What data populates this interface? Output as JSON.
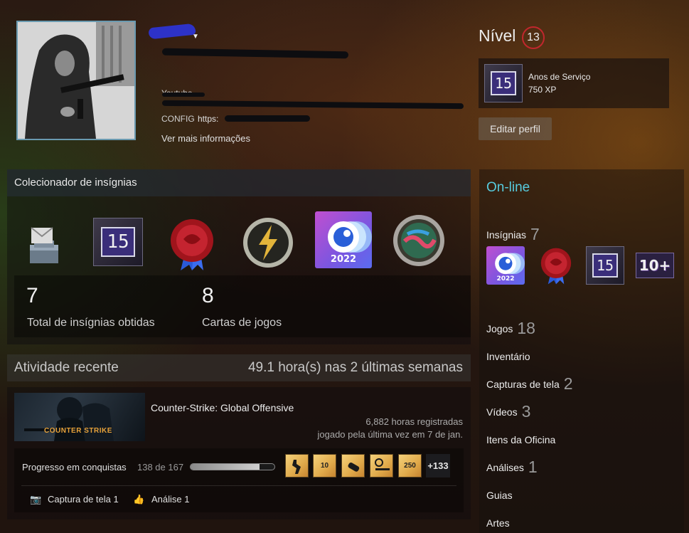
{
  "profile": {
    "info_label_1": "Youtube",
    "info_label_2": "CONFIG",
    "info_value_2": "https:",
    "more_info": "Ver mais informações"
  },
  "level": {
    "label": "Nível",
    "value": "13"
  },
  "favorite_badge": {
    "number": "15",
    "title": "Anos de Serviço",
    "xp": "750 XP"
  },
  "edit_profile": "Editar perfil",
  "collector": {
    "title": "Colecionador de insígnias",
    "badges": [
      {
        "icon": "envelope-stack-icon",
        "label": ""
      },
      {
        "icon": "years-of-service-icon",
        "label": "15"
      },
      {
        "icon": "wax-seal-icon",
        "label": ""
      },
      {
        "icon": "lightning-icon",
        "label": ""
      },
      {
        "icon": "steam-replay-icon",
        "label": "2022"
      },
      {
        "icon": "porthole-icon",
        "label": ""
      }
    ],
    "total_value": "7",
    "total_label": "Total de insígnias obtidas",
    "cards_value": "8",
    "cards_label": "Cartas de jogos"
  },
  "recent": {
    "title": "Atividade recente",
    "hours": "49.1 hora(s) nas 2 últimas semanas",
    "game": {
      "logo": "COUNTER STRIKE",
      "name": "Counter-Strike: Global Offensive",
      "hours_on_record": "6,882 horas registradas",
      "last_played": "jogado pela última vez em 7 de jan."
    },
    "achievements": {
      "label": "Progresso em conquistas",
      "count": "138 de 167",
      "progress": 0.826,
      "icons": [
        {
          "icon": "soldier-achievement-icon",
          "label": ""
        },
        {
          "icon": "ten-achievement-icon",
          "label": "10"
        },
        {
          "icon": "grenade-achievement-icon",
          "label": ""
        },
        {
          "icon": "target-rifle-achievement-icon",
          "label": ""
        },
        {
          "icon": "rifle-250-achievement-icon",
          "label": "250"
        }
      ],
      "more": "+133"
    },
    "screenshot_label": "Captura de tela 1",
    "review_label": "Análise 1"
  },
  "sidebar": {
    "status": "On-line",
    "badges_label": "Insígnias",
    "badges_count": "7",
    "badges": [
      {
        "icon": "steam-replay-icon",
        "label": "2022"
      },
      {
        "icon": "wax-seal-icon",
        "label": ""
      },
      {
        "icon": "years-of-service-icon",
        "label": "15"
      },
      {
        "icon": "ten-plus-icon",
        "label": "10+"
      }
    ],
    "items": [
      {
        "label": "Jogos",
        "count": "18"
      },
      {
        "label": "Inventário",
        "count": ""
      },
      {
        "label": "Capturas de tela",
        "count": "2"
      },
      {
        "label": "Vídeos",
        "count": "3"
      },
      {
        "label": "Itens da Oficina",
        "count": ""
      },
      {
        "label": "Análises",
        "count": "1"
      },
      {
        "label": "Guias",
        "count": ""
      },
      {
        "label": "Artes",
        "count": ""
      }
    ]
  },
  "colors": {
    "online": "#57cbde",
    "level_ring": "#c1272d"
  }
}
